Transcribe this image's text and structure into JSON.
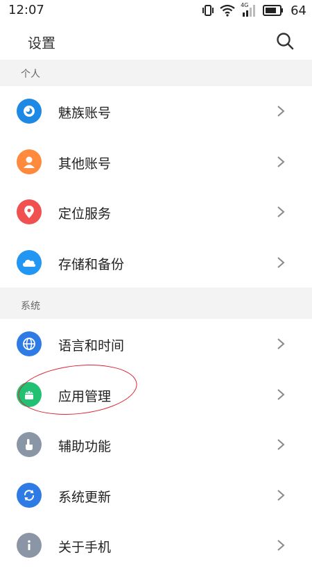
{
  "status_bar": {
    "time": "12:07",
    "network": "4G",
    "battery": "64"
  },
  "header": {
    "title": "设置",
    "search_icon": "search-icon"
  },
  "sections": [
    {
      "label": "个人",
      "items": [
        {
          "label": "魅族账号",
          "icon": "flyme-account-icon",
          "color": "#1e88e5"
        },
        {
          "label": "其他账号",
          "icon": "person-icon",
          "color": "#ff8a3d"
        },
        {
          "label": "定位服务",
          "icon": "location-pin-icon",
          "color": "#f05050"
        },
        {
          "label": "存储和备份",
          "icon": "cloud-icon",
          "color": "#2196f3"
        }
      ]
    },
    {
      "label": "系统",
      "items": [
        {
          "label": "语言和时间",
          "icon": "globe-icon",
          "color": "#2f7be5"
        },
        {
          "label": "应用管理",
          "icon": "android-app-icon",
          "color": "#22c073"
        },
        {
          "label": "辅助功能",
          "icon": "hand-pointer-icon",
          "color": "#8a96a5"
        },
        {
          "label": "系统更新",
          "icon": "refresh-icon",
          "color": "#2f7be5"
        },
        {
          "label": "关于手机",
          "icon": "info-icon",
          "color": "#8a96a5"
        }
      ]
    }
  ],
  "annotation_color": "#dd2233"
}
